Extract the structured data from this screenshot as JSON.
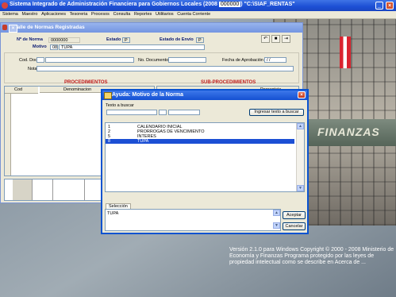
{
  "app": {
    "title": "Sistema Integrado de Administración Financiera para Gobiernos Locales (2008 ",
    "title_id": "000000",
    "title_suffix": ") \"C:\\SIAF_RENTAS\""
  },
  "menu": [
    "Sistema",
    "Maestro",
    "Aplicaciones",
    "Tesoreria",
    "Procesos",
    "Consulta",
    "Reportes",
    "Utilitarios",
    "Cuenta Corriente"
  ],
  "child_window": {
    "title": "Detalle de Normas Registradas",
    "nro_norma_label": "Nº de Norma",
    "nro_norma_value": "0000000",
    "estado_label": "Estado",
    "estado_value": "P",
    "estado_envio_label": "Estado de Envío",
    "estado_envio_value": "P",
    "motivo_label": "Motivo",
    "motivo_code": "08",
    "motivo_value": "TUPA",
    "cod_doc_label": "Cod. Doc.",
    "no_documento_label": "No. Documento",
    "fecha_aprobacion_label": "Fecha de Aprobación",
    "fecha_aprobacion_value": "/ /",
    "notas_label": "Notas",
    "procedimientos_header": "PROCEDIMIENTOS",
    "subprocedimientos_header": "SUB-PROCEDIMIENTOS",
    "col_cod": "Cod",
    "col_denominacion": "Denominacion",
    "col_porcentaje": "Porcentaje"
  },
  "modal": {
    "title": "Ayuda: Motivo de la Norma",
    "search_label": "Texto a buscar",
    "search_button": "Ingresar texto a buscar",
    "items": [
      {
        "code": "1",
        "desc": "CALENDARIO INICIAL"
      },
      {
        "code": "2",
        "desc": "PRORROGAS DE VENCIMIENTO"
      },
      {
        "code": "5",
        "desc": "INTERES"
      },
      {
        "code": "8",
        "desc": "TUPA"
      }
    ],
    "selected_index": 3,
    "selection_tab": "Selección",
    "selection_value": "TUPA",
    "accept_button": "Aceptar",
    "cancel_button": "Cancelar"
  },
  "background": {
    "sign_text": "FINANZAS",
    "copyright": "Versión 2.1.0 para Windows Copyright © 2000 - 2008 Ministerio de Economía y Finanzas Programa protegido por las leyes de propiedad intelectual como se describe en Acerca de ..."
  }
}
